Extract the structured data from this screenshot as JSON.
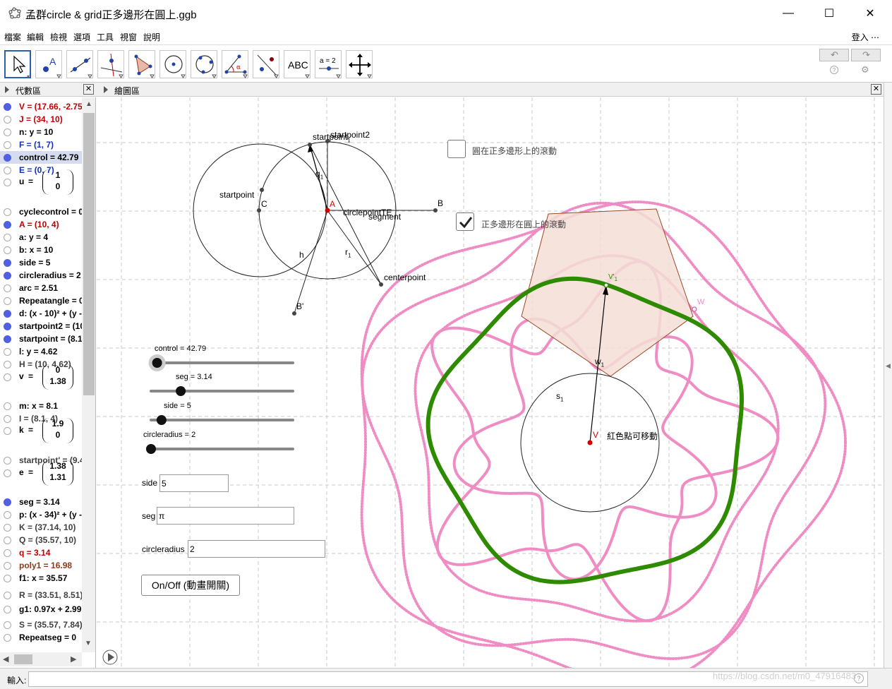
{
  "window": {
    "title": "孟群circle & grid正多邊形在圓上.ggb",
    "minimize": "—",
    "maximize": "☐",
    "close": "✕"
  },
  "menu": {
    "items": [
      "檔案",
      "編輯",
      "檢視",
      "選項",
      "工具",
      "視窗",
      "說明"
    ],
    "login": "登入 ⋯"
  },
  "toolbar": {
    "text_tool_label": "ABC",
    "slider_tool_label": "a = 2",
    "undo": "↶",
    "redo": "↷",
    "help": "?",
    "settings": "⚙"
  },
  "algebra_panel": {
    "title": "代數區",
    "rows": [
      {
        "text": "V = (17.66, -2.75",
        "color": "#c00000",
        "on": true
      },
      {
        "text": "J = (34, 10)",
        "color": "#c00000",
        "on": false
      },
      {
        "text": "n: y = 10",
        "color": "#000000",
        "on": false
      },
      {
        "text": "F = (1, 7)",
        "color": "#1030c0",
        "on": false
      },
      {
        "text": "control = 42.79",
        "color": "#000000",
        "on": true
      },
      {
        "text": "E = (0, 7)",
        "color": "#1030c0",
        "on": false
      },
      {
        "text": "u  =  (1 0)",
        "color": "#000000",
        "on": false
      },
      {
        "text": "cyclecontrol = 0",
        "color": "#000000",
        "on": false
      },
      {
        "text": "A = (10, 4)",
        "color": "#c00000",
        "on": true
      },
      {
        "text": "a: y = 4",
        "color": "#000000",
        "on": false
      },
      {
        "text": "b: x = 10",
        "color": "#000000",
        "on": false
      },
      {
        "text": "side = 5",
        "color": "#000000",
        "on": true
      },
      {
        "text": "circleradius = 2",
        "color": "#000000",
        "on": true
      },
      {
        "text": "arc = 2.51",
        "color": "#000000",
        "on": false
      },
      {
        "text": "Repeatangle = 0",
        "color": "#000000",
        "on": false
      },
      {
        "text": "d: (x - 10)² + (y -",
        "color": "#000000",
        "on": true
      },
      {
        "text": "startpoint2 = (10",
        "color": "#000000",
        "on": true
      },
      {
        "text": "startpoint = (8.1",
        "color": "#000000",
        "on": true
      },
      {
        "text": "l: y = 4.62",
        "color": "#000000",
        "on": false
      },
      {
        "text": "H = (10, 4.62)",
        "color": "#404040",
        "on": false
      },
      {
        "text": "v  =  (0 1.38)",
        "color": "#000000",
        "on": false
      },
      {
        "text": "m: x = 8.1",
        "color": "#000000",
        "on": false
      },
      {
        "text": "I = (8.1, 4)",
        "color": "#404040",
        "on": false
      },
      {
        "text": "k  =  (1.9 0)",
        "color": "#000000",
        "on": false
      },
      {
        "text": "startpoint' = (9.4",
        "color": "#404040",
        "on": false
      },
      {
        "text": "e  =  (1.38 1.31)",
        "color": "#000000",
        "on": false
      },
      {
        "text": "seg = 3.14",
        "color": "#000000",
        "on": true
      },
      {
        "text": "p: (x - 34)² + (y -",
        "color": "#000000",
        "on": false
      },
      {
        "text": "K = (37.14, 10)",
        "color": "#404040",
        "on": false
      },
      {
        "text": "Q = (35.57, 10)",
        "color": "#404040",
        "on": false
      },
      {
        "text": "q = 3.14",
        "color": "#c00000",
        "on": false
      },
      {
        "text": "poly1 = 16.98",
        "color": "#8b3a1a",
        "on": false
      },
      {
        "text": "f1: x = 35.57",
        "color": "#000000",
        "on": false
      },
      {
        "text": "R = (33.51, 8.51)",
        "color": "#404040",
        "on": false
      },
      {
        "text": "g1: 0.97x + 2.99",
        "color": "#000000",
        "on": false
      },
      {
        "text": "S = (35.57, 7.84)",
        "color": "#404040",
        "on": false
      },
      {
        "text": "Repeatseg = 0",
        "color": "#000000",
        "on": false
      }
    ],
    "vectors": {
      "u": {
        "name": "u",
        "top": "1",
        "bottom": "0"
      },
      "v": {
        "name": "v",
        "top": "0",
        "bottom": "1.38"
      },
      "k": {
        "name": "k",
        "top": "1.9",
        "bottom": "0"
      },
      "e": {
        "name": "e",
        "top": "1.38",
        "bottom": "1.31"
      }
    }
  },
  "graphics_panel": {
    "title": "繪圖區",
    "sliders": [
      {
        "label": "control = 42.79",
        "value": 42.79,
        "min": 0,
        "max": 1000
      },
      {
        "label": "seg = 3.14",
        "value": 3.14,
        "min": 0,
        "max": 15
      },
      {
        "label": "side = 5",
        "value": 5,
        "min": 3,
        "max": 30
      },
      {
        "label": "circleradius = 2",
        "value": 2,
        "min": 2,
        "max": 10
      }
    ],
    "inputs": [
      {
        "label": "side",
        "value": "5"
      },
      {
        "label": "seg",
        "value": "π"
      },
      {
        "label": "circleradius",
        "value": "2"
      }
    ],
    "button": "On/Off (動畫開關)",
    "checkbox1": {
      "label": "圓在正多邊形上的滾動",
      "checked": false
    },
    "checkbox2": {
      "label": "正多邊形在圓上的滾動",
      "checked": true
    },
    "labels": {
      "startpoint": "startpoint",
      "startpoint1": "startpoint",
      "startpoint2": "startpoint2",
      "C": "C",
      "A": "A",
      "B": "B",
      "Bprime": "B'",
      "q1": "q",
      "h": "h",
      "r1": "r",
      "circlepoint": "circlepoint",
      "segment": "segment",
      "centerpoint": "centerpoint",
      "V": "V",
      "V1": "V'",
      "W": "W",
      "w1": "w",
      "s1": "s",
      "red_point_movable": "紅色點可移動",
      "sub1": "1",
      "prime_one": "1",
      "TE": "TE"
    }
  },
  "input_bar": {
    "label": "輸入:",
    "watermark": "https://blog.csdn.net/m0_47916483"
  },
  "colors": {
    "accent": "#2b5fb0",
    "green_curve": "#2e8b00",
    "pink_curve": "#f08cc4",
    "polygon_fill": "#f3ded6",
    "polygon_edge": "#9c4a26"
  }
}
